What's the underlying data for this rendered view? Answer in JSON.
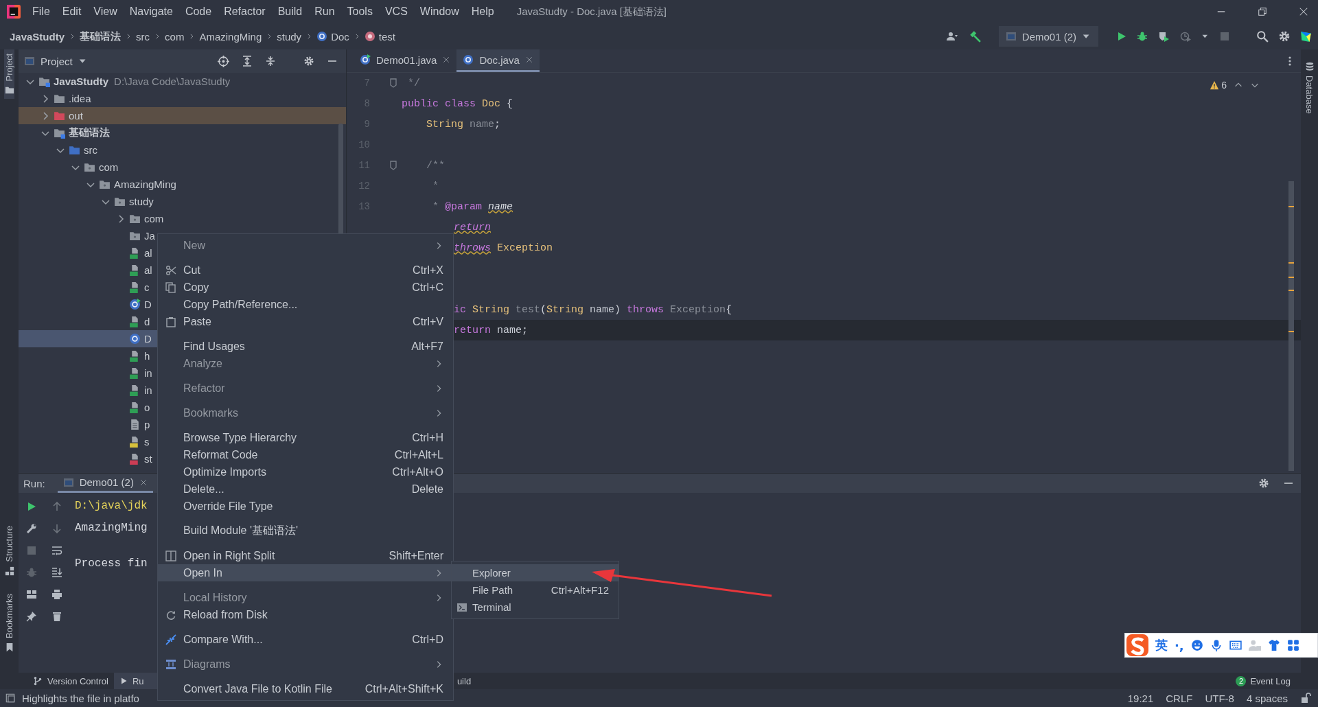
{
  "menu_bar": {
    "items": [
      "File",
      "Edit",
      "View",
      "Navigate",
      "Code",
      "Refactor",
      "Build",
      "Run",
      "Tools",
      "VCS",
      "Window",
      "Help"
    ],
    "title": "JavaStudty - Doc.java [基础语法]"
  },
  "breadcrumb": [
    {
      "label": "JavaStudty",
      "kind": "bold"
    },
    {
      "label": "基础语法",
      "kind": "bold"
    },
    {
      "label": "src",
      "kind": "plain"
    },
    {
      "label": "com",
      "kind": "plain"
    },
    {
      "label": "AmazingMing",
      "kind": "plain"
    },
    {
      "label": "study",
      "kind": "plain"
    },
    {
      "label": "Doc",
      "kind": "class"
    },
    {
      "label": "test",
      "kind": "method"
    }
  ],
  "run_configuration": "Demo01 (2)",
  "left_strip": {
    "top": "Project",
    "bottom": [
      "Structure",
      "Bookmarks"
    ]
  },
  "right_strip": {
    "top": "Database"
  },
  "project": {
    "title": "Project",
    "tree": [
      {
        "label": "JavaStudty",
        "path": "D:\\Java Code\\JavaStudty",
        "kind": "project",
        "expanded": true,
        "selected": false,
        "children": [
          {
            "label": ".idea",
            "kind": "folder",
            "expanded": false,
            "selected": false
          },
          {
            "label": "out",
            "kind": "excluded",
            "expanded": false,
            "selected": false
          },
          {
            "label": "基础语法",
            "kind": "module",
            "expanded": true,
            "selected": false,
            "children": [
              {
                "label": "src",
                "kind": "source",
                "expanded": true,
                "selected": false,
                "children": [
                  {
                    "label": "com",
                    "kind": "package",
                    "expanded": true,
                    "selected": false,
                    "children": [
                      {
                        "label": "AmazingMing",
                        "kind": "package",
                        "expanded": true,
                        "selected": false,
                        "children": [
                          {
                            "label": "study",
                            "kind": "package",
                            "expanded": true,
                            "selected": false,
                            "children": [
                              {
                                "label": "com",
                                "kind": "package",
                                "expanded": false,
                                "selected": false
                              },
                              {
                                "label": "Ja",
                                "kind": "package",
                                "selected": false
                              },
                              {
                                "label": "al",
                                "kind": "html",
                                "selected": false
                              },
                              {
                                "label": "al",
                                "kind": "html",
                                "selected": false
                              },
                              {
                                "label": "c",
                                "kind": "html",
                                "selected": false
                              },
                              {
                                "label": "D",
                                "kind": "runnable",
                                "selected": false
                              },
                              {
                                "label": "d",
                                "kind": "html",
                                "selected": false
                              },
                              {
                                "label": "D",
                                "kind": "class",
                                "selected": true
                              },
                              {
                                "label": "h",
                                "kind": "html",
                                "selected": false
                              },
                              {
                                "label": "in",
                                "kind": "html",
                                "selected": false
                              },
                              {
                                "label": "in",
                                "kind": "html",
                                "selected": false
                              },
                              {
                                "label": "o",
                                "kind": "html",
                                "selected": false
                              },
                              {
                                "label": "p",
                                "kind": "text",
                                "selected": false
                              },
                              {
                                "label": "s",
                                "kind": "js",
                                "selected": false
                              },
                              {
                                "label": "st",
                                "kind": "css",
                                "selected": false
                              }
                            ]
                          }
                        ]
                      }
                    ]
                  }
                ]
              }
            ]
          }
        ]
      }
    ]
  },
  "editor": {
    "tabs": [
      {
        "label": "Demo01.java",
        "kind": "runnable",
        "selected": false
      },
      {
        "label": "Doc.java",
        "kind": "class",
        "selected": true
      }
    ],
    "warnings": "6",
    "lines": [
      {
        "number": "7",
        "fold": true,
        "covered": false,
        "current": false,
        "tokens": [
          {
            "text": " */",
            "kind": "comment"
          }
        ]
      },
      {
        "number": "8",
        "fold": false,
        "covered": false,
        "current": false,
        "tokens": [
          {
            "text": "public class",
            "kind": "keyword"
          },
          {
            "text": " Doc",
            "kind": "type"
          },
          {
            "text": " {",
            "kind": "plain"
          }
        ]
      },
      {
        "number": "9",
        "fold": false,
        "covered": false,
        "current": false,
        "tokens": [
          {
            "text": "    String",
            "kind": "type"
          },
          {
            "text": " name",
            "kind": "unused"
          },
          {
            "text": ";",
            "kind": "plain"
          }
        ]
      },
      {
        "number": "10",
        "fold": false,
        "current": false
      },
      {
        "number": "11",
        "fold": true,
        "covered": false,
        "current": false,
        "tokens": [
          {
            "text": "    /**",
            "kind": "comment"
          }
        ]
      },
      {
        "number": "12",
        "fold": false,
        "covered": false,
        "current": false,
        "tokens": [
          {
            "text": "     *",
            "kind": "comment"
          }
        ]
      },
      {
        "number": "13",
        "fold": false,
        "covered": false,
        "current": false,
        "tokens": [
          {
            "text": "     * ",
            "kind": "comment"
          },
          {
            "text": "@param ",
            "kind": "tag"
          },
          {
            "text": "name",
            "kind": "param-warn"
          }
        ]
      },
      {
        "covered": true,
        "current": false,
        "tokens": [
          {
            "text": "return",
            "kind": "tag-warn"
          }
        ]
      },
      {
        "covered": true,
        "current": false,
        "tokens": [
          {
            "text": "throws",
            "kind": "tag-warn"
          },
          {
            "text": " Exception",
            "kind": "type"
          }
        ]
      },
      {
        "current": false
      },
      {
        "current": false
      },
      {
        "covered": true,
        "current": false,
        "tokens": [
          {
            "text": "ic",
            "kind": "keyword"
          },
          {
            "text": " String",
            "kind": "type"
          },
          {
            "text": " test",
            "kind": "unused"
          },
          {
            "text": "(",
            "kind": "plain"
          },
          {
            "text": "String",
            "kind": "type"
          },
          {
            "text": " name) ",
            "kind": "plain"
          },
          {
            "text": "throws",
            "kind": "keyword"
          },
          {
            "text": " Exception",
            "kind": "unused"
          },
          {
            "text": "{",
            "kind": "plain"
          }
        ]
      },
      {
        "covered": true,
        "current": true,
        "tokens": [
          {
            "text": "return",
            "kind": "keyword"
          },
          {
            "text": " name;",
            "kind": "plain"
          }
        ]
      }
    ]
  },
  "context_menu": {
    "items": [
      {
        "label": "New",
        "kind": "plain",
        "submenu": true,
        "disabled": true,
        "selected": false
      },
      {
        "kind": "separator"
      },
      {
        "label": "Cut",
        "shortcut": "Ctrl+X",
        "kind": "cut",
        "submenu": false,
        "disabled": false,
        "selected": false
      },
      {
        "label": "Copy",
        "shortcut": "Ctrl+C",
        "kind": "copy",
        "submenu": false,
        "disabled": false,
        "selected": false
      },
      {
        "label": "Copy Path/Reference...",
        "kind": "plain",
        "submenu": false,
        "disabled": false,
        "selected": false
      },
      {
        "label": "Paste",
        "shortcut": "Ctrl+V",
        "kind": "paste",
        "submenu": false,
        "disabled": false,
        "selected": false
      },
      {
        "kind": "separator"
      },
      {
        "label": "Find Usages",
        "shortcut": "Alt+F7",
        "kind": "plain",
        "submenu": false,
        "disabled": false,
        "selected": false
      },
      {
        "label": "Analyze",
        "kind": "plain",
        "submenu": true,
        "disabled": true,
        "selected": false
      },
      {
        "kind": "separator"
      },
      {
        "label": "Refactor",
        "kind": "plain",
        "submenu": true,
        "disabled": true,
        "selected": false
      },
      {
        "kind": "separator"
      },
      {
        "label": "Bookmarks",
        "kind": "plain",
        "submenu": true,
        "disabled": true,
        "selected": false
      },
      {
        "kind": "separator"
      },
      {
        "label": "Browse Type Hierarchy",
        "shortcut": "Ctrl+H",
        "kind": "plain",
        "submenu": false,
        "disabled": false,
        "selected": false
      },
      {
        "label": "Reformat Code",
        "shortcut": "Ctrl+Alt+L",
        "kind": "plain",
        "submenu": false,
        "disabled": false,
        "selected": false
      },
      {
        "label": "Optimize Imports",
        "shortcut": "Ctrl+Alt+O",
        "kind": "plain",
        "submenu": false,
        "disabled": false,
        "selected": false
      },
      {
        "label": "Delete...",
        "shortcut": "Delete",
        "kind": "plain",
        "submenu": false,
        "disabled": false,
        "selected": false
      },
      {
        "label": "Override File Type",
        "kind": "plain",
        "submenu": false,
        "disabled": false,
        "selected": false
      },
      {
        "kind": "separator"
      },
      {
        "label": "Build Module '基础语法'",
        "kind": "plain",
        "submenu": false,
        "disabled": false,
        "selected": false
      },
      {
        "kind": "separator"
      },
      {
        "label": "Open in Right Split",
        "shortcut": "Shift+Enter",
        "kind": "split",
        "submenu": false,
        "disabled": false,
        "selected": false
      },
      {
        "label": "Open In",
        "kind": "plain",
        "submenu": true,
        "disabled": false,
        "selected": true
      },
      {
        "kind": "separator"
      },
      {
        "label": "Local History",
        "kind": "plain",
        "submenu": true,
        "disabled": true,
        "selected": false
      },
      {
        "label": "Reload from Disk",
        "kind": "reload",
        "submenu": false,
        "disabled": false,
        "selected": false
      },
      {
        "kind": "separator"
      },
      {
        "label": "Compare With...",
        "shortcut": "Ctrl+D",
        "kind": "compare",
        "submenu": false,
        "disabled": false,
        "selected": false
      },
      {
        "kind": "separator"
      },
      {
        "label": "Diagrams",
        "kind": "diagram",
        "submenu": true,
        "disabled": true,
        "selected": false
      },
      {
        "kind": "separator"
      },
      {
        "label": "Convert Java File to Kotlin File",
        "shortcut": "Ctrl+Alt+Shift+K",
        "kind": "plain",
        "submenu": false,
        "disabled": false,
        "selected": false
      }
    ]
  },
  "submenu": {
    "items": [
      {
        "label": "Explorer",
        "kind": "plain",
        "selected": true
      },
      {
        "label": "File Path",
        "shortcut": "Ctrl+Alt+F12",
        "kind": "plain",
        "selected": false
      },
      {
        "label": "Terminal",
        "kind": "terminal",
        "selected": false
      }
    ]
  },
  "run": {
    "label": "Run:",
    "tab": "Demo01 (2)",
    "console": [
      {
        "text": "D:\\java\\jdk",
        "kind": "command"
      },
      {
        "text": "AmazingMing",
        "kind": "output"
      },
      {
        "text": "Process fin",
        "kind": "exit"
      }
    ]
  },
  "bottom_strip": {
    "tabs": [
      {
        "label": "Version Control",
        "kind": "vcs",
        "selected": false
      },
      {
        "label": "Ru",
        "kind": "run",
        "selected": true
      },
      {
        "label": "uild",
        "kind": "build",
        "selected": false
      }
    ],
    "event_log": {
      "label": "Event Log",
      "count": "2"
    }
  },
  "status_bar": {
    "message": "Highlights the file in platfo",
    "items": [
      "19:21",
      "CRLF",
      "UTF-8",
      "4 spaces"
    ]
  },
  "ime_bar": {
    "mode": "英",
    "punctuation": "·,"
  }
}
